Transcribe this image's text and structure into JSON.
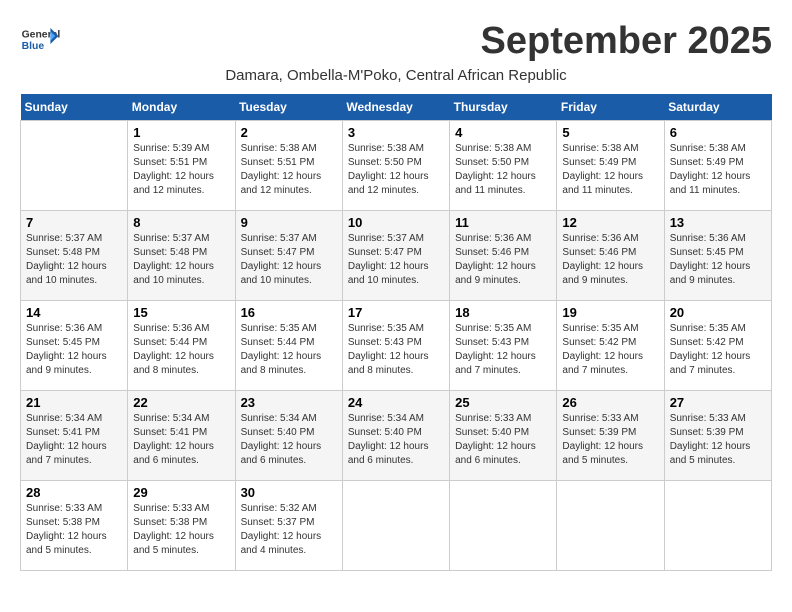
{
  "logo": {
    "general": "General",
    "blue": "Blue"
  },
  "title": "September 2025",
  "subtitle": "Damara, Ombella-M'Poko, Central African Republic",
  "headers": [
    "Sunday",
    "Monday",
    "Tuesday",
    "Wednesday",
    "Thursday",
    "Friday",
    "Saturday"
  ],
  "weeks": [
    [
      {
        "day": "",
        "info": ""
      },
      {
        "day": "1",
        "info": "Sunrise: 5:39 AM\nSunset: 5:51 PM\nDaylight: 12 hours\nand 12 minutes."
      },
      {
        "day": "2",
        "info": "Sunrise: 5:38 AM\nSunset: 5:51 PM\nDaylight: 12 hours\nand 12 minutes."
      },
      {
        "day": "3",
        "info": "Sunrise: 5:38 AM\nSunset: 5:50 PM\nDaylight: 12 hours\nand 12 minutes."
      },
      {
        "day": "4",
        "info": "Sunrise: 5:38 AM\nSunset: 5:50 PM\nDaylight: 12 hours\nand 11 minutes."
      },
      {
        "day": "5",
        "info": "Sunrise: 5:38 AM\nSunset: 5:49 PM\nDaylight: 12 hours\nand 11 minutes."
      },
      {
        "day": "6",
        "info": "Sunrise: 5:38 AM\nSunset: 5:49 PM\nDaylight: 12 hours\nand 11 minutes."
      }
    ],
    [
      {
        "day": "7",
        "info": "Sunrise: 5:37 AM\nSunset: 5:48 PM\nDaylight: 12 hours\nand 10 minutes."
      },
      {
        "day": "8",
        "info": "Sunrise: 5:37 AM\nSunset: 5:48 PM\nDaylight: 12 hours\nand 10 minutes."
      },
      {
        "day": "9",
        "info": "Sunrise: 5:37 AM\nSunset: 5:47 PM\nDaylight: 12 hours\nand 10 minutes."
      },
      {
        "day": "10",
        "info": "Sunrise: 5:37 AM\nSunset: 5:47 PM\nDaylight: 12 hours\nand 10 minutes."
      },
      {
        "day": "11",
        "info": "Sunrise: 5:36 AM\nSunset: 5:46 PM\nDaylight: 12 hours\nand 9 minutes."
      },
      {
        "day": "12",
        "info": "Sunrise: 5:36 AM\nSunset: 5:46 PM\nDaylight: 12 hours\nand 9 minutes."
      },
      {
        "day": "13",
        "info": "Sunrise: 5:36 AM\nSunset: 5:45 PM\nDaylight: 12 hours\nand 9 minutes."
      }
    ],
    [
      {
        "day": "14",
        "info": "Sunrise: 5:36 AM\nSunset: 5:45 PM\nDaylight: 12 hours\nand 9 minutes."
      },
      {
        "day": "15",
        "info": "Sunrise: 5:36 AM\nSunset: 5:44 PM\nDaylight: 12 hours\nand 8 minutes."
      },
      {
        "day": "16",
        "info": "Sunrise: 5:35 AM\nSunset: 5:44 PM\nDaylight: 12 hours\nand 8 minutes."
      },
      {
        "day": "17",
        "info": "Sunrise: 5:35 AM\nSunset: 5:43 PM\nDaylight: 12 hours\nand 8 minutes."
      },
      {
        "day": "18",
        "info": "Sunrise: 5:35 AM\nSunset: 5:43 PM\nDaylight: 12 hours\nand 7 minutes."
      },
      {
        "day": "19",
        "info": "Sunrise: 5:35 AM\nSunset: 5:42 PM\nDaylight: 12 hours\nand 7 minutes."
      },
      {
        "day": "20",
        "info": "Sunrise: 5:35 AM\nSunset: 5:42 PM\nDaylight: 12 hours\nand 7 minutes."
      }
    ],
    [
      {
        "day": "21",
        "info": "Sunrise: 5:34 AM\nSunset: 5:41 PM\nDaylight: 12 hours\nand 7 minutes."
      },
      {
        "day": "22",
        "info": "Sunrise: 5:34 AM\nSunset: 5:41 PM\nDaylight: 12 hours\nand 6 minutes."
      },
      {
        "day": "23",
        "info": "Sunrise: 5:34 AM\nSunset: 5:40 PM\nDaylight: 12 hours\nand 6 minutes."
      },
      {
        "day": "24",
        "info": "Sunrise: 5:34 AM\nSunset: 5:40 PM\nDaylight: 12 hours\nand 6 minutes."
      },
      {
        "day": "25",
        "info": "Sunrise: 5:33 AM\nSunset: 5:40 PM\nDaylight: 12 hours\nand 6 minutes."
      },
      {
        "day": "26",
        "info": "Sunrise: 5:33 AM\nSunset: 5:39 PM\nDaylight: 12 hours\nand 5 minutes."
      },
      {
        "day": "27",
        "info": "Sunrise: 5:33 AM\nSunset: 5:39 PM\nDaylight: 12 hours\nand 5 minutes."
      }
    ],
    [
      {
        "day": "28",
        "info": "Sunrise: 5:33 AM\nSunset: 5:38 PM\nDaylight: 12 hours\nand 5 minutes."
      },
      {
        "day": "29",
        "info": "Sunrise: 5:33 AM\nSunset: 5:38 PM\nDaylight: 12 hours\nand 5 minutes."
      },
      {
        "day": "30",
        "info": "Sunrise: 5:32 AM\nSunset: 5:37 PM\nDaylight: 12 hours\nand 4 minutes."
      },
      {
        "day": "",
        "info": ""
      },
      {
        "day": "",
        "info": ""
      },
      {
        "day": "",
        "info": ""
      },
      {
        "day": "",
        "info": ""
      }
    ]
  ]
}
